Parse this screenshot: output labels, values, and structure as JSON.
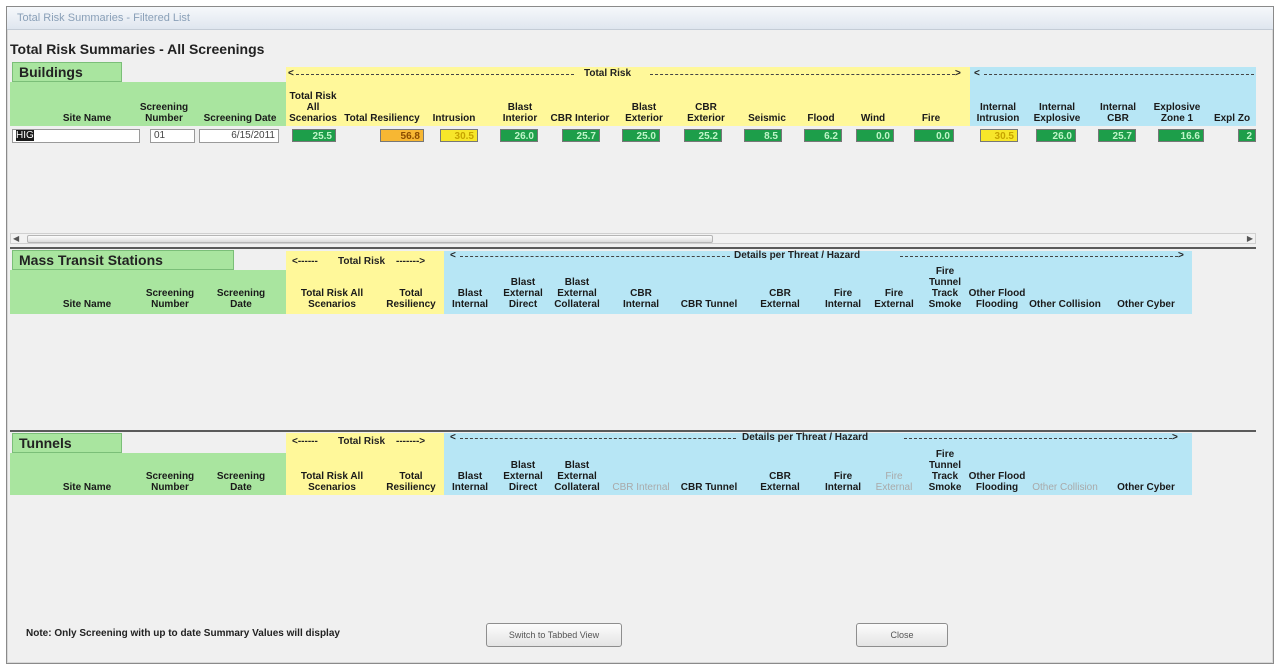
{
  "window": {
    "title": "Total Risk Summaries - Filtered List"
  },
  "heading": "Total Risk Summaries - All Screenings",
  "buildings": {
    "title": "Buildings",
    "group_total_risk": "Total Risk",
    "cols": {
      "site_name": "Site Name",
      "screening_number": "Screening Number",
      "screening_date": "Screening Date",
      "total_risk_all": "Total Risk All Scenarios",
      "total_resiliency": "Total Resiliency",
      "intrusion": "Intrusion",
      "blast_interior": "Blast Interior",
      "cbr_interior": "CBR Interior",
      "blast_exterior": "Blast Exterior",
      "cbr_exterior": "CBR Exterior",
      "seismic": "Seismic",
      "flood": "Flood",
      "wind": "Wind",
      "fire": "Fire",
      "internal_intrusion": "Internal Intrusion",
      "internal_explosive": "Internal Explosive",
      "internal_cbr": "Internal CBR",
      "explosive_zone1": "Explosive Zone 1",
      "expl_zone_partial": "Expl Zo"
    },
    "row": {
      "site_name": "HIG",
      "screening_number": "01",
      "screening_date": "6/15/2011",
      "total_risk_all": "25.5",
      "total_resiliency": "56.8",
      "intrusion": "30.5",
      "blast_interior": "26.0",
      "cbr_interior": "25.7",
      "blast_exterior": "25.0",
      "cbr_exterior": "25.2",
      "seismic": "8.5",
      "flood": "6.2",
      "wind": "0.0",
      "fire": "0.0",
      "internal_intrusion": "30.5",
      "internal_explosive": "26.0",
      "internal_cbr": "25.7",
      "explosive_zone1": "16.6",
      "expl_zone_partial": "2"
    }
  },
  "mass_transit": {
    "title": "Mass Transit Stations",
    "group_total_risk": "Total Risk",
    "group_details": "Details per Threat / Hazard",
    "cols": {
      "site_name": "Site Name",
      "screening_number": "Screening Number",
      "screening_date": "Screening Date",
      "total_risk_all": "Total Risk All Scenarios",
      "total_resiliency": "Total Resiliency",
      "blast_internal": "Blast Internal",
      "blast_external_direct": "Blast External Direct",
      "blast_external_collateral": "Blast External Collateral",
      "cbr_internal": "CBR Internal",
      "cbr_tunnel": "CBR Tunnel",
      "cbr_external": "CBR External",
      "fire_internal": "Fire Internal",
      "fire_external": "Fire External",
      "fire_tunnel_track_smoke": "Fire Tunnel Track Smoke",
      "other_flood_flooding": "Other Flood Flooding",
      "other_collision": "Other Collision",
      "other_cyber": "Other Cyber"
    }
  },
  "tunnels": {
    "title": "Tunnels",
    "group_total_risk": "Total Risk",
    "group_details": "Details per Threat / Hazard",
    "cols": {
      "site_name": "Site Name",
      "screening_number": "Screening Number",
      "screening_date": "Screening Date",
      "total_risk_all": "Total Risk All Scenarios",
      "total_resiliency": "Total Resiliency",
      "blast_internal": "Blast Internal",
      "blast_external_direct": "Blast External Direct",
      "blast_external_collateral": "Blast External Collateral",
      "cbr_internal": "CBR Internal",
      "cbr_tunnel": "CBR Tunnel",
      "cbr_external": "CBR External",
      "fire_internal": "Fire Internal",
      "fire_external": "Fire External",
      "fire_tunnel_track_smoke": "Fire Tunnel Track Smoke",
      "other_flood_flooding": "Other Flood Flooding",
      "other_collision": "Other Collision",
      "other_cyber": "Other Cyber"
    }
  },
  "footer": {
    "note": "Note: Only Screening with up to date Summary Values will display",
    "switch_button": "Switch to Tabbed View",
    "close_button": "Close"
  },
  "colors": {
    "header_green": "#a9e59f",
    "header_yellow": "#fff89a",
    "header_blue": "#b7e6f5",
    "value_green": "#1d9e4a",
    "value_yellow": "#f7e62a",
    "value_orange": "#f7b733"
  },
  "icons": {
    "scroll_left": "arrow-left-icon",
    "scroll_right": "arrow-right-icon"
  }
}
